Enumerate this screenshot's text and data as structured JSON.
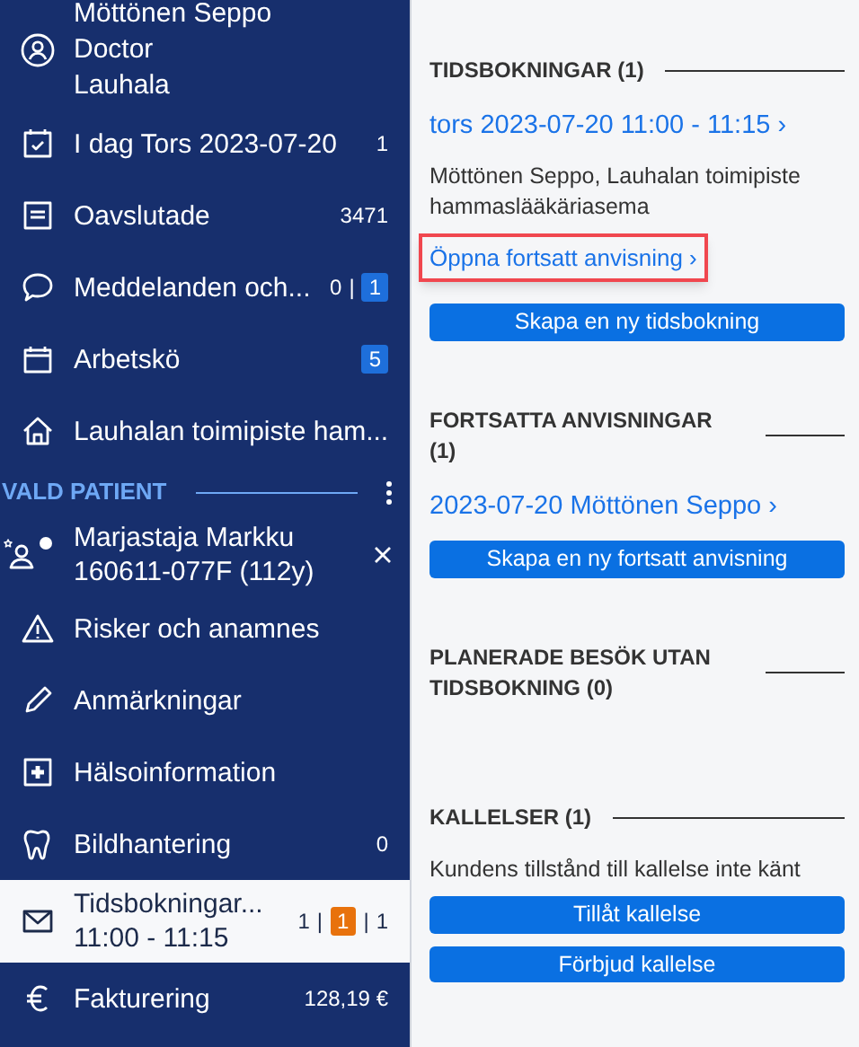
{
  "sidebar": {
    "user": {
      "lines": [
        "Möttönen Seppo",
        "Doctor",
        "Lauhala"
      ]
    },
    "items": [
      {
        "label": "I dag Tors 2023-07-20",
        "selected": false,
        "counts": [
          {
            "kind": "plain",
            "text": "1"
          }
        ]
      },
      {
        "label": "Oavslutade",
        "selected": false,
        "counts": [
          {
            "kind": "plain",
            "text": "3471"
          }
        ]
      },
      {
        "label": "Meddelanden och...",
        "selected": false,
        "counts": [
          {
            "kind": "plain",
            "text": "0"
          },
          {
            "kind": "sep",
            "text": "|"
          },
          {
            "kind": "badge",
            "text": "1",
            "color": "#1e6fdb"
          }
        ]
      },
      {
        "label": "Arbetskö",
        "selected": false,
        "counts": [
          {
            "kind": "badge",
            "text": "5",
            "color": "#1e6fdb"
          }
        ]
      },
      {
        "label": "Lauhalan toimipiste ham...",
        "selected": false
      }
    ],
    "patient_section": {
      "title": "VALD PATIENT",
      "patient": {
        "name": "Marjastaja Markku",
        "id": "160611-077F (112y)"
      }
    },
    "patient_items": [
      {
        "label": "Risker och anamnes",
        "selected": false
      },
      {
        "label": "Anmärkningar",
        "selected": false
      },
      {
        "label": "Hälsoinformation",
        "selected": false
      },
      {
        "label": "Bildhantering",
        "selected": false,
        "counts": [
          {
            "kind": "plain",
            "text": "0"
          }
        ]
      },
      {
        "label": "Tidsbokningar...",
        "sublabel": "11:00 - 11:15",
        "selected": true,
        "counts": [
          {
            "kind": "plain",
            "text": "1"
          },
          {
            "kind": "sep",
            "text": "|"
          },
          {
            "kind": "badge",
            "text": "1",
            "color": "#e8720c"
          },
          {
            "kind": "sep",
            "text": "|"
          },
          {
            "kind": "plain",
            "text": "1"
          }
        ]
      },
      {
        "label": "Fakturering",
        "selected": false,
        "counts": [
          {
            "kind": "plain",
            "text": "128,19 €"
          }
        ]
      }
    ]
  },
  "panel": {
    "sections": [
      {
        "title": "TIDSBOKNINGAR (1)",
        "entries": [
          {
            "kind": "link",
            "text": "tors 2023-07-20 11:00 - 11:15 ›",
            "highlighted": false
          },
          {
            "kind": "text",
            "text": "Möttönen Seppo, Lauhalan toimipiste hammaslääkäriasema"
          },
          {
            "kind": "link",
            "text": "Öppna fortsatt anvisning ›",
            "highlighted": true
          },
          {
            "kind": "button",
            "text": "Skapa en ny tidsbokning"
          }
        ]
      },
      {
        "title": "FORTSATTA ANVISNINGAR (1)",
        "entries": [
          {
            "kind": "link",
            "text": "2023-07-20 Möttönen Seppo ›",
            "highlighted": false
          },
          {
            "kind": "button",
            "text": "Skapa en ny fortsatt anvisning"
          }
        ]
      },
      {
        "title": "PLANERADE BESÖK UTAN TIDSBOKNING (0)"
      },
      {
        "title": "KALLELSER (1)",
        "entries": [
          {
            "kind": "text",
            "text": "Kundens tillstånd till kallelse inte känt"
          },
          {
            "kind": "button",
            "text": "Tillåt kallelse"
          },
          {
            "kind": "button",
            "text": "Förbjud kallelse"
          }
        ]
      }
    ]
  }
}
